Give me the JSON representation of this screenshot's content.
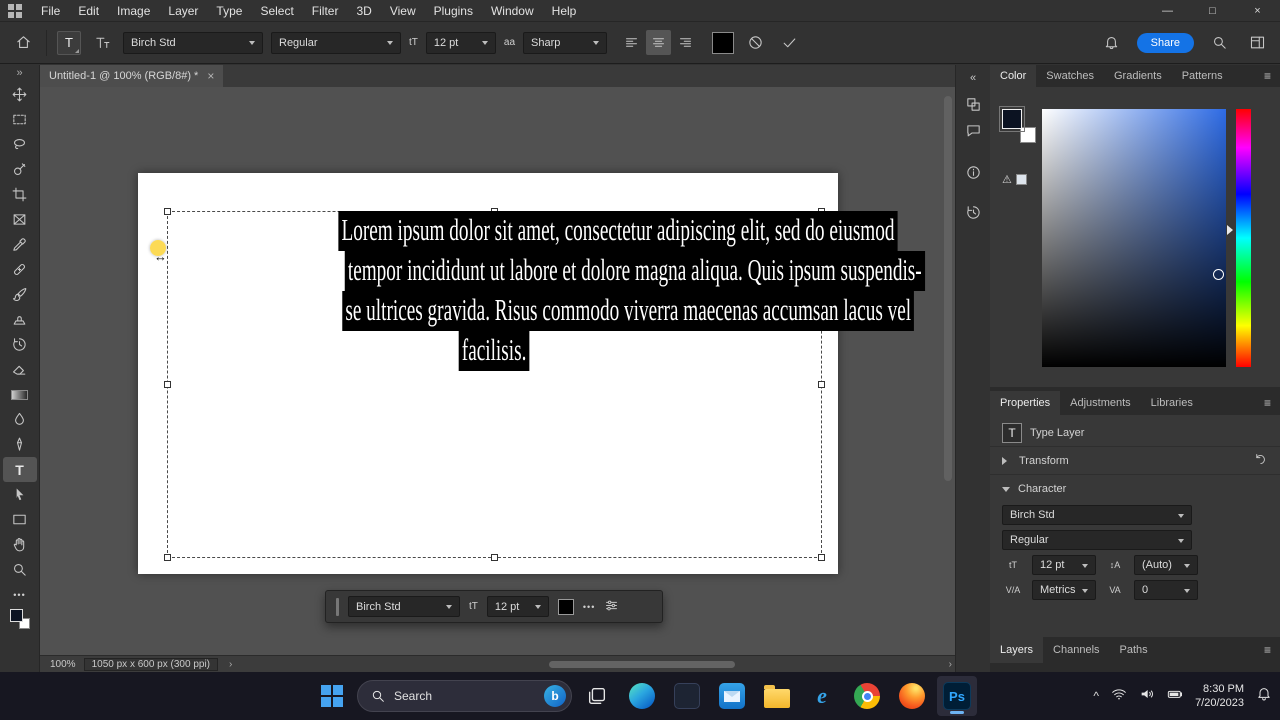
{
  "menubar": {
    "items": [
      "File",
      "Edit",
      "Image",
      "Layer",
      "Type",
      "Select",
      "Filter",
      "3D",
      "View",
      "Plugins",
      "Window",
      "Help"
    ]
  },
  "options": {
    "font_family": "Birch Std",
    "font_style": "Regular",
    "font_size": "12 pt",
    "anti_alias": "Sharp",
    "share": "Share"
  },
  "doc_tab": {
    "title": "Untitled-1 @ 100% (RGB/8#) *"
  },
  "canvas_text": {
    "lines": [
      "Lorem ipsum dolor sit amet, consectetur adipiscing elit, sed do eiusmod",
      "tempor incididunt ut labore et dolore magna aliqua. Quis ipsum suspendis-",
      "se ultrices gravida. Risus commodo viverra maecenas accumsan lacus vel",
      "facilisis."
    ]
  },
  "mini_toolbar": {
    "font_family": "Birch Std",
    "font_size": "12 pt"
  },
  "status": {
    "zoom": "100%",
    "dimensions": "1050 px x 600 px (300 ppi)"
  },
  "color_panel": {
    "tabs": [
      "Color",
      "Swatches",
      "Gradients",
      "Patterns"
    ]
  },
  "properties_panel": {
    "tabs": [
      "Properties",
      "Adjustments",
      "Libraries"
    ],
    "layer_type": "Type Layer",
    "transform_label": "Transform",
    "character_label": "Character",
    "font_family": "Birch Std",
    "font_style": "Regular",
    "font_size": "12 pt",
    "leading": "(Auto)",
    "tracking": "Metrics",
    "kerning": "0"
  },
  "layers_panel": {
    "tabs": [
      "Layers",
      "Channels",
      "Paths"
    ]
  },
  "taskbar": {
    "search": "Search",
    "time": "8:30 PM",
    "date": "7/20/2023",
    "ps_label": "Ps",
    "bing_label": "b",
    "ie_label": "e"
  },
  "glyphs": {
    "expand_tools": "»",
    "collapse_panels": "«",
    "minimize": "—",
    "maximize": "□",
    "close": "×",
    "tab_close": "×",
    "ellipsis": "•••",
    "menu": "≡",
    "warning": "⚠",
    "popup_chevron": "›",
    "scroll_right": "›",
    "size_icon": "tT",
    "aa_icon": "aa",
    "leading_icon": "↕A",
    "tracking_icon": "V/A",
    "kerning_icon": "VA",
    "type_icon": "T",
    "resize_cursor": "↔",
    "tray_chevron": "^"
  }
}
